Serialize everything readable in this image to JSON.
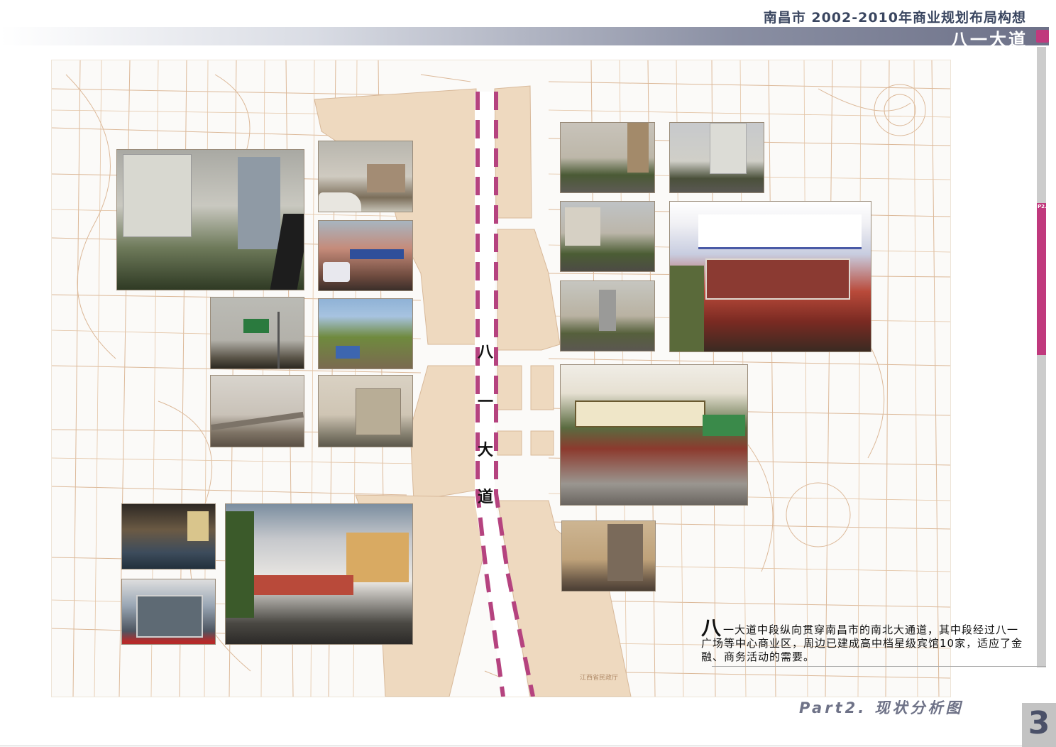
{
  "header": {
    "title": "南昌市 2002-2010年商业规划布局构想",
    "section": "八一大道"
  },
  "map": {
    "road_label": [
      "八",
      "一",
      "大",
      "道"
    ],
    "district_label": "江西省民政厅",
    "colors": {
      "block_fill": "#eed9bf",
      "road_dash": "#b5437f",
      "street_lines": "#caa07a",
      "accent": "#c0397d"
    }
  },
  "sidebar": {
    "label": "P2."
  },
  "photos": [
    {
      "name": "photo-highrise-towers",
      "icon": "photo-icon"
    },
    {
      "name": "photo-street-junction",
      "icon": "photo-icon"
    },
    {
      "name": "photo-shopping-crowd",
      "icon": "photo-icon"
    },
    {
      "name": "photo-green-road-sign",
      "icon": "photo-icon"
    },
    {
      "name": "photo-tree-lined-street",
      "icon": "photo-icon"
    },
    {
      "name": "photo-foggy-overpass",
      "icon": "photo-icon"
    },
    {
      "name": "photo-hazy-building",
      "icon": "photo-icon"
    },
    {
      "name": "photo-hotel-lobby",
      "icon": "photo-icon"
    },
    {
      "name": "photo-furniture-mall",
      "icon": "photo-icon"
    },
    {
      "name": "photo-store-entrance",
      "icon": "photo-icon"
    },
    {
      "name": "photo-boulevard-traffic",
      "icon": "photo-icon"
    },
    {
      "name": "photo-avenue-towers",
      "icon": "photo-icon"
    },
    {
      "name": "photo-street-trees",
      "icon": "photo-icon"
    },
    {
      "name": "photo-road-buildings",
      "icon": "photo-icon"
    },
    {
      "name": "photo-xinhua-hotel",
      "icon": "photo-icon"
    },
    {
      "name": "photo-yuyuan-hotel",
      "icon": "photo-icon"
    },
    {
      "name": "photo-dusk-buildings",
      "icon": "photo-icon"
    }
  ],
  "description": {
    "lead_char": "八",
    "text": "一大道中段纵向贯穿南昌市的南北大通道，其中段经过八一广场等中心商业区，周边已建成高中档星级宾馆10家，适应了金融、商务活动的需要。"
  },
  "footer": {
    "part": "Part2.  现状分析图",
    "page_number": "3"
  }
}
